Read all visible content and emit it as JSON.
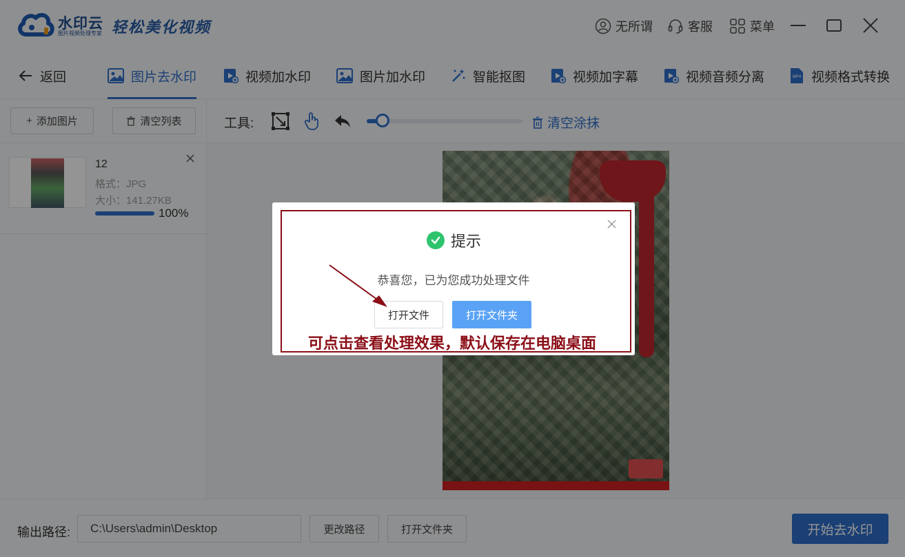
{
  "app": {
    "brand_name": "水印云",
    "brand_sub": "图片视频处理专家",
    "slogan": "轻松美化视频",
    "user_label": "无所谓",
    "service_label": "客服",
    "menu_label": "菜单"
  },
  "nav": {
    "back_label": "返回",
    "tabs": [
      {
        "label": "图片去水印",
        "icon": "image-icon",
        "active": true
      },
      {
        "label": "视频加水印",
        "icon": "video-icon",
        "active": false
      },
      {
        "label": "图片加水印",
        "icon": "image-icon",
        "active": false
      },
      {
        "label": "智能抠图",
        "icon": "magic-wand-icon",
        "active": false
      },
      {
        "label": "视频加字幕",
        "icon": "video-icon",
        "active": false
      },
      {
        "label": "视频音频分离",
        "icon": "video-icon",
        "active": false
      },
      {
        "label": "视频格式转换",
        "icon": "mp4-file-icon",
        "active": false
      }
    ]
  },
  "left_panel": {
    "add_label": "添加图片",
    "clear_label": "清空列表",
    "files": [
      {
        "name": "12",
        "format": "格式：JPG",
        "size": "大小：141.27KB",
        "progress": 1.0,
        "percent_text": "100%"
      }
    ]
  },
  "editor": {
    "tools_label": "工具:",
    "brush_size": 0.1,
    "clear_smear_label": "清空涂抹"
  },
  "bottom": {
    "output_label": "输出路径:",
    "output_path": "C:\\Users\\admin\\Desktop",
    "change_path_label": "更改路径",
    "open_folder_label": "打开文件夹",
    "start_label": "开始去水印"
  },
  "dialog": {
    "title": "提示",
    "message": "恭喜您，已为您成功处理文件",
    "open_file_label": "打开文件",
    "open_folder_label": "打开文件夹",
    "annotation": "可点击查看处理效果，默认保存在电脑桌面"
  },
  "colors": {
    "accent": "#2f6fca",
    "dialog_primary": "#5aa2f5",
    "success": "#2ec46e",
    "annotation": "#8b0e17"
  }
}
